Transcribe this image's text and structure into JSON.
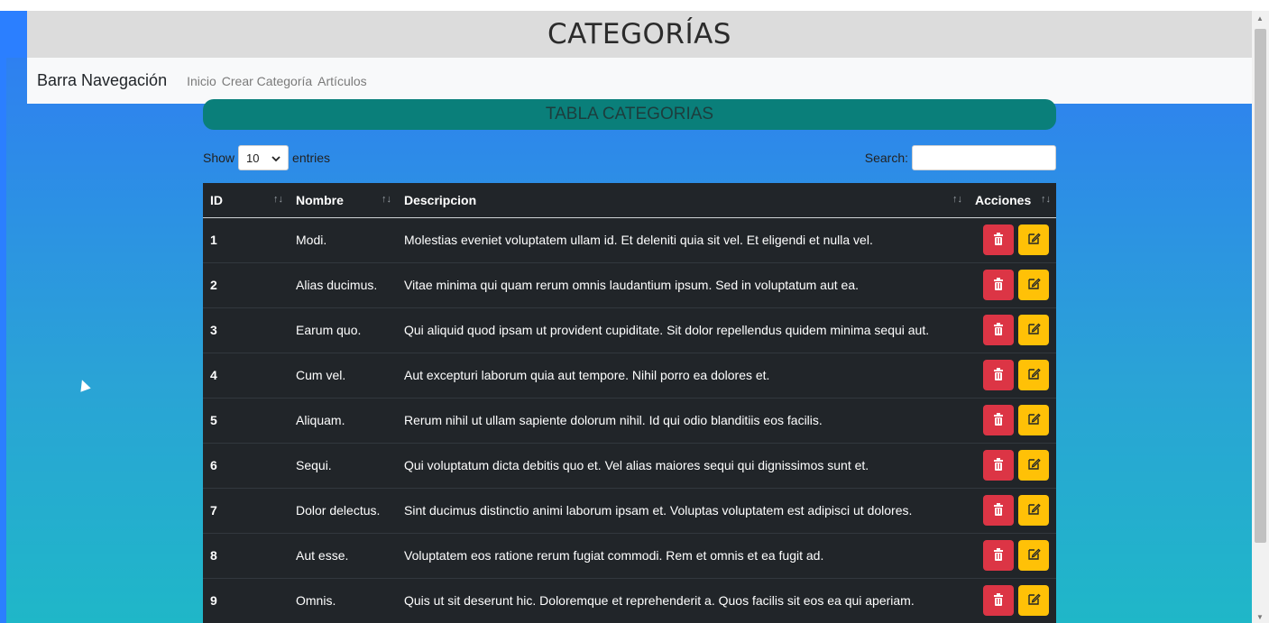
{
  "header": {
    "title": "CATEGORÍAS"
  },
  "navbar": {
    "brand": "Barra Navegación",
    "links": [
      "Inicio",
      "Crear Categoría",
      "Artículos"
    ]
  },
  "banner": {
    "title": "TABLA CATEGORIAS"
  },
  "controls": {
    "show_label": "Show",
    "entries_value": "10",
    "entries_label": "entries",
    "search_label": "Search:",
    "search_value": ""
  },
  "table": {
    "headers": [
      "ID",
      "Nombre",
      "Descripcion",
      "Acciones"
    ],
    "rows": [
      {
        "id": "1",
        "nombre": "Modi.",
        "descripcion": "Molestias eveniet voluptatem ullam id. Et deleniti quia sit vel. Et eligendi et nulla vel."
      },
      {
        "id": "2",
        "nombre": "Alias ducimus.",
        "descripcion": "Vitae minima qui quam rerum omnis laudantium ipsum. Sed in voluptatum aut ea."
      },
      {
        "id": "3",
        "nombre": "Earum quo.",
        "descripcion": "Qui aliquid quod ipsam ut provident cupiditate. Sit dolor repellendus quidem minima sequi aut."
      },
      {
        "id": "4",
        "nombre": "Cum vel.",
        "descripcion": "Aut excepturi laborum quia aut tempore. Nihil porro ea dolores et."
      },
      {
        "id": "5",
        "nombre": "Aliquam.",
        "descripcion": "Rerum nihil ut ullam sapiente dolorum nihil. Id qui odio blanditiis eos facilis."
      },
      {
        "id": "6",
        "nombre": "Sequi.",
        "descripcion": "Qui voluptatum dicta debitis quo et. Vel alias maiores sequi qui dignissimos sunt et."
      },
      {
        "id": "7",
        "nombre": "Dolor delectus.",
        "descripcion": "Sint ducimus distinctio animi laborum ipsam et. Voluptas voluptatem est adipisci ut dolores."
      },
      {
        "id": "8",
        "nombre": "Aut esse.",
        "descripcion": "Voluptatem eos ratione rerum fugiat commodi. Rem et omnis et ea fugit ad."
      },
      {
        "id": "9",
        "nombre": "Omnis.",
        "descripcion": "Quis ut sit deserunt hic. Doloremque et reprehenderit a. Quos facilis sit eos ea qui aperiam."
      }
    ]
  },
  "colors": {
    "delete_button": "#dc3545",
    "edit_button": "#ffc107",
    "banner": "#0a7f7a",
    "table_bg": "#212529"
  },
  "icons": {
    "delete": "trash-icon",
    "edit": "edit-icon",
    "sort": "sort-icon",
    "select": "chevron-down-icon"
  }
}
